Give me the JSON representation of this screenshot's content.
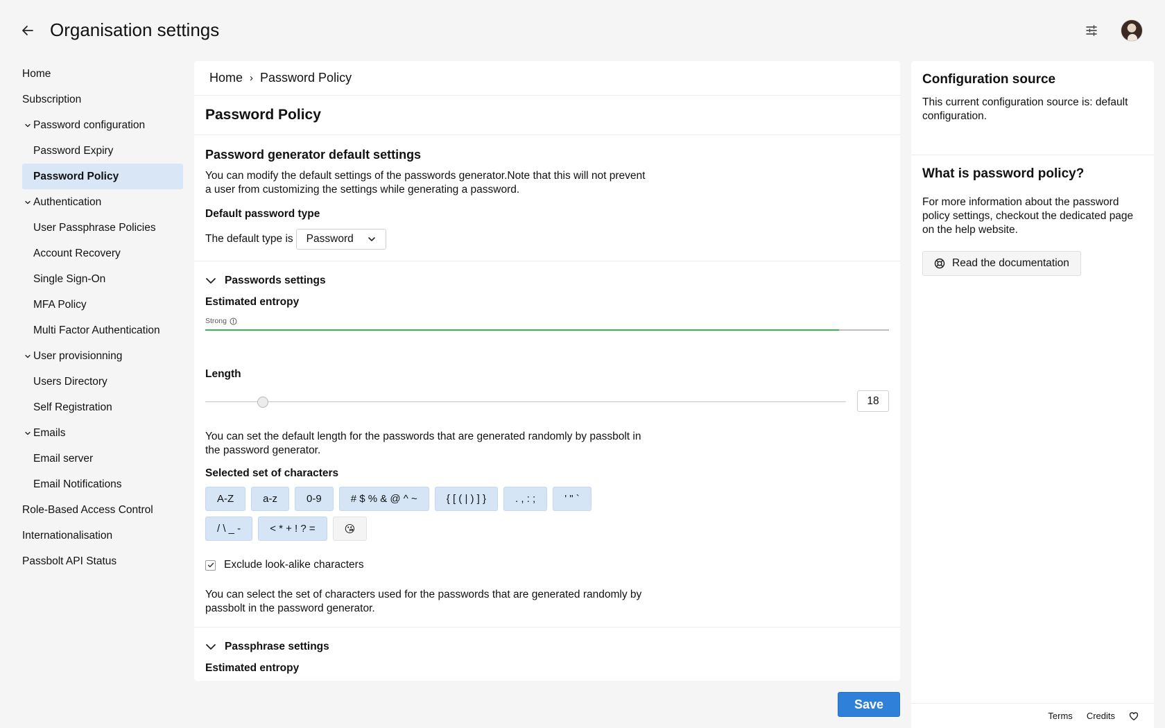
{
  "header": {
    "title": "Organisation settings"
  },
  "sidebar": {
    "items": [
      {
        "label": "Home",
        "level": 0
      },
      {
        "label": "Subscription",
        "level": 0
      },
      {
        "label": "Password configuration",
        "level": 0,
        "group": true
      },
      {
        "label": "Password Expiry",
        "level": 1
      },
      {
        "label": "Password Policy",
        "level": 1,
        "active": true
      },
      {
        "label": "Authentication",
        "level": 0,
        "group": true
      },
      {
        "label": "User Passphrase Policies",
        "level": 1
      },
      {
        "label": "Account Recovery",
        "level": 1
      },
      {
        "label": "Single Sign-On",
        "level": 1
      },
      {
        "label": "MFA Policy",
        "level": 1
      },
      {
        "label": "Multi Factor Authentication",
        "level": 1
      },
      {
        "label": "User provisionning",
        "level": 0,
        "group": true
      },
      {
        "label": "Users Directory",
        "level": 1
      },
      {
        "label": "Self Registration",
        "level": 1
      },
      {
        "label": "Emails",
        "level": 0,
        "group": true
      },
      {
        "label": "Email server",
        "level": 1
      },
      {
        "label": "Email Notifications",
        "level": 1
      },
      {
        "label": "Role-Based Access Control",
        "level": 0
      },
      {
        "label": "Internationalisation",
        "level": 0
      },
      {
        "label": "Passbolt API Status",
        "level": 0
      }
    ]
  },
  "breadcrumb": {
    "home": "Home",
    "sep": "›",
    "current": "Password Policy"
  },
  "main": {
    "title": "Password Policy",
    "generator_title": "Password generator default settings",
    "generator_desc": "You can modify the default settings of the passwords generator.Note that this will not prevent a user from customizing the settings while generating a password.",
    "default_type_label": "Default password type",
    "default_type_prefix": "The default type is",
    "default_type_value": "Password",
    "passwords_settings": "Passwords settings",
    "entropy_label": "Estimated entropy",
    "entropy_strength": "Strong",
    "entropy_fraction": 0.927,
    "length_label": "Length",
    "length_value": "18",
    "length_fraction": 0.09,
    "length_desc": "You can set the default length for the passwords that are generated randomly by passbolt in the password generator.",
    "charset_label": "Selected set of characters",
    "charsets": [
      {
        "label": "A-Z",
        "on": true
      },
      {
        "label": "a-z",
        "on": true
      },
      {
        "label": "0-9",
        "on": true
      },
      {
        "label": "# $ % & @ ^ ~",
        "on": true
      },
      {
        "label": "{ [ ( | ) ] }",
        "on": true
      },
      {
        "label": ". , : ;",
        "on": true
      },
      {
        "label": "' \" `",
        "on": true
      },
      {
        "label": "/ \\ _ -",
        "on": true
      },
      {
        "label": "< * + ! ? =",
        "on": true
      },
      {
        "label": "😘",
        "on": false
      }
    ],
    "exclude_label": "Exclude look-alike characters",
    "exclude_checked": true,
    "charset_desc": "You can select the set of characters used for the passwords that are generated randomly by passbolt in the password generator.",
    "passphrase_settings": "Passphrase settings",
    "passphrase_entropy_label": "Estimated entropy"
  },
  "side": {
    "source_title": "Configuration source",
    "source_desc": "This current configuration source is: default configuration.",
    "what_title": "What is password policy?",
    "what_desc": "For more information about the password policy settings, checkout the dedicated page on the help website.",
    "doc_button": "Read the documentation",
    "footer_terms": "Terms",
    "footer_credits": "Credits"
  },
  "actions": {
    "save": "Save"
  }
}
